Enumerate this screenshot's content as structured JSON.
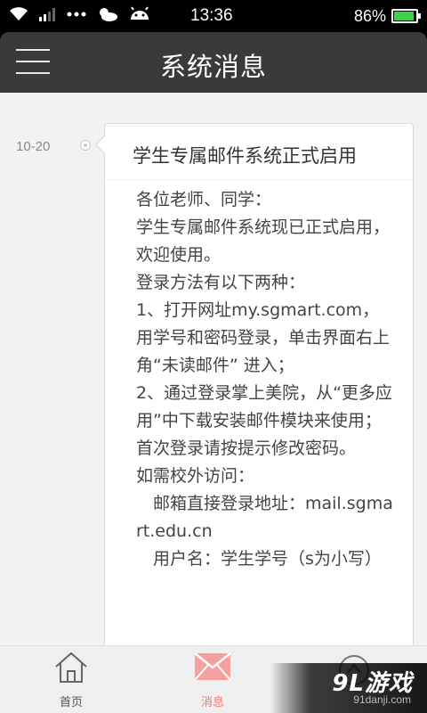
{
  "status_bar": {
    "time": "13:36",
    "battery_text": "86%",
    "battery_level": 0.86,
    "battery_color": "#3ed14a"
  },
  "header": {
    "title": "系统消息",
    "menu_icon": "hamburger-menu-icon"
  },
  "messages": [
    {
      "date": "10-20",
      "title": "学生专属邮件系统正式启用",
      "lines": [
        "各位老师、同学：",
        "学生专属邮件系统现已正式启用，欢迎使用。",
        "登录方法有以下两种：",
        "1、打开网址my.sgmart.com，用学号和密码登录，单击界面右上角“未读邮件” 进入；",
        "2、通过登录掌上美院，从“更多应用”中下载安装邮件模块来使用；",
        "首次登录请按提示修改密码。",
        "如需校外访问：",
        "　邮箱直接登录地址：mail.sgmart.edu.cn",
        "　用户名：学生学号（s为小写）"
      ]
    }
  ],
  "bottom_nav": {
    "items": [
      {
        "label": "首页",
        "icon": "home-icon",
        "active": false
      },
      {
        "label": "消息",
        "icon": "mail-icon",
        "active": true
      }
    ],
    "active_color": "#f07a7a"
  },
  "watermark": {
    "logo": "9L游戏",
    "url": "91danji.com"
  }
}
